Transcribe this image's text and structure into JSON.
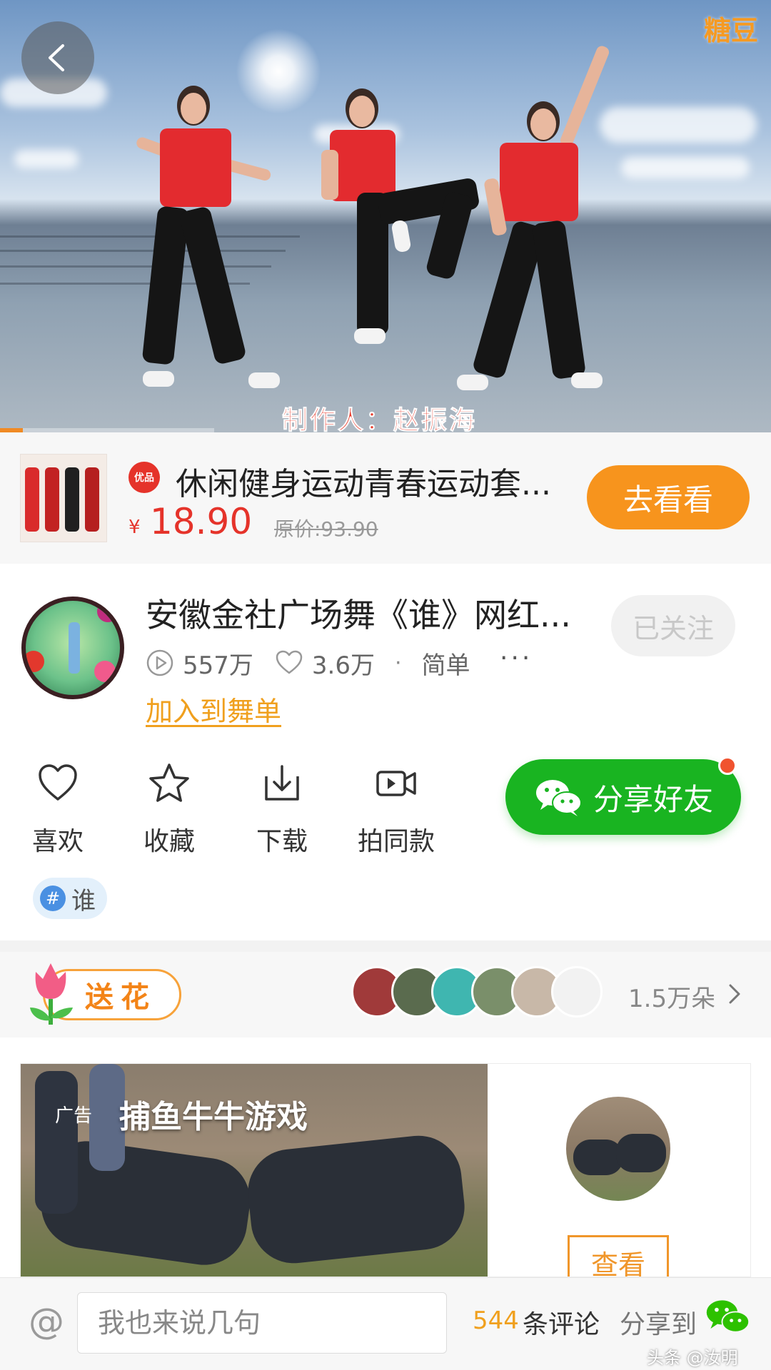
{
  "video": {
    "brand_logo": "糖豆",
    "caption": "制作人：赵振海",
    "progress_fraction": 0.03
  },
  "product": {
    "badge": "优品",
    "title": "休闲健身运动青春运动套...",
    "price_symbol": "¥",
    "price": "18.90",
    "original_price": "原价:93.90",
    "cta_label": "去看看"
  },
  "dance": {
    "title": "安徽金社广场舞《谁》网红...",
    "follow_label": "已关注",
    "plays": "557万",
    "likes": "3.6万",
    "separator": "·",
    "difficulty": "简单",
    "more": "···",
    "add_to_list": "加入到舞单"
  },
  "actions": {
    "like": "喜欢",
    "favorite": "收藏",
    "download": "下载",
    "shoot_same": "拍同款",
    "share_friends": "分享好友"
  },
  "tag": {
    "hash": "#",
    "name": "谁"
  },
  "flowers": {
    "send_label": "送花",
    "count": "1.5万朵"
  },
  "ad": {
    "tag": "广告",
    "title": "捕鱼牛牛游戏",
    "view_label": "查看"
  },
  "bottom": {
    "at": "@",
    "input_placeholder": "我也来说几句",
    "comment_count": "544",
    "comment_label": "条评论",
    "share_to": "分享到",
    "watermark": "头条 @汝明"
  },
  "colors": {
    "accent_orange": "#f7941d",
    "price_red": "#e5332a",
    "wechat_green": "#19b421"
  }
}
